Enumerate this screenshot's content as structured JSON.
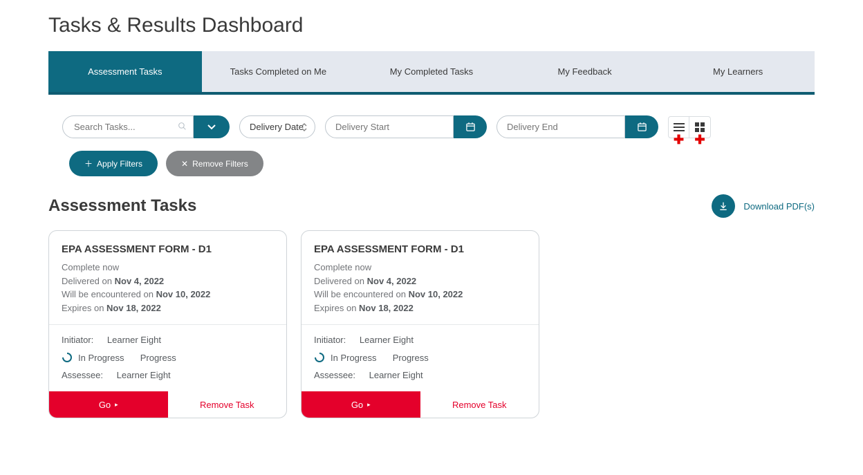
{
  "page_title": "Tasks & Results Dashboard",
  "tabs": [
    {
      "label": "Assessment Tasks",
      "active": true
    },
    {
      "label": "Tasks Completed on Me",
      "active": false
    },
    {
      "label": "My Completed Tasks",
      "active": false
    },
    {
      "label": "My Feedback",
      "active": false
    },
    {
      "label": "My Learners",
      "active": false
    }
  ],
  "filters": {
    "search_placeholder": "Search Tasks...",
    "sort_label": "Delivery Date",
    "delivery_start_placeholder": "Delivery Start",
    "delivery_end_placeholder": "Delivery End",
    "apply_label": "Apply Filters",
    "remove_label": "Remove Filters"
  },
  "section_title": "Assessment Tasks",
  "download_label": "Download PDF(s)",
  "cards": [
    {
      "title": "EPA ASSESSMENT FORM - D1",
      "complete_now": "Complete now",
      "delivered_prefix": "Delivered on ",
      "delivered_date": "Nov 4, 2022",
      "encounter_prefix": "Will be encountered on ",
      "encounter_date": "Nov 10, 2022",
      "expires_prefix": "Expires on ",
      "expires_date": "Nov 18, 2022",
      "initiator_label": "Initiator:",
      "initiator_name": "Learner Eight",
      "status1": "In Progress",
      "status2": "Progress",
      "assessee_label": "Assessee:",
      "assessee_name": "Learner Eight",
      "go_label": "Go",
      "remove_task_label": "Remove Task"
    },
    {
      "title": "EPA ASSESSMENT FORM - D1",
      "complete_now": "Complete now",
      "delivered_prefix": "Delivered on ",
      "delivered_date": "Nov 4, 2022",
      "encounter_prefix": "Will be encountered on ",
      "encounter_date": "Nov 10, 2022",
      "expires_prefix": "Expires on ",
      "expires_date": "Nov 18, 2022",
      "initiator_label": "Initiator:",
      "initiator_name": "Learner Eight",
      "status1": "In Progress",
      "status2": "Progress",
      "assessee_label": "Assessee:",
      "assessee_name": "Learner Eight",
      "go_label": "Go",
      "remove_task_label": "Remove Task"
    }
  ]
}
